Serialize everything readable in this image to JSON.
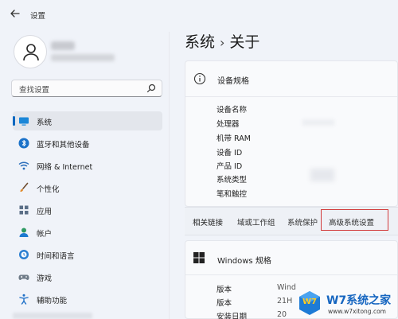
{
  "window": {
    "title": "设置"
  },
  "search": {
    "placeholder": "查找设置"
  },
  "sidebar": {
    "items": [
      {
        "label": "系统",
        "icon": "monitor-icon",
        "active": true
      },
      {
        "label": "蓝牙和其他设备",
        "icon": "bluetooth-icon"
      },
      {
        "label": "网络 & Internet",
        "icon": "wifi-icon"
      },
      {
        "label": "个性化",
        "icon": "brush-icon"
      },
      {
        "label": "应用",
        "icon": "apps-icon"
      },
      {
        "label": "帐户",
        "icon": "account-icon"
      },
      {
        "label": "时间和语言",
        "icon": "globe-clock-icon"
      },
      {
        "label": "游戏",
        "icon": "gamepad-icon"
      },
      {
        "label": "辅助功能",
        "icon": "accessibility-icon"
      }
    ]
  },
  "breadcrumb": {
    "parent": "系统",
    "separator": "›",
    "current": "关于"
  },
  "device_specs": {
    "title": "设备规格",
    "rows": [
      {
        "label": "设备名称"
      },
      {
        "label": "处理器"
      },
      {
        "label": "机带 RAM"
      },
      {
        "label": "设备 ID"
      },
      {
        "label": "产品 ID"
      },
      {
        "label": "系统类型"
      },
      {
        "label": "笔和触控"
      }
    ]
  },
  "related_links": {
    "label": "相关链接",
    "links": [
      "域或工作组",
      "系统保护",
      "高级系统设置"
    ]
  },
  "windows_specs": {
    "title": "Windows 规格",
    "rows": [
      {
        "label": "版本",
        "value": "Wind"
      },
      {
        "label": "版本",
        "value": "21H"
      },
      {
        "label": "安装日期",
        "value": "20"
      }
    ]
  },
  "watermark": {
    "badge": "W7",
    "text": "W7系统之家",
    "url": "www.w7xitong.com"
  },
  "colors": {
    "accent": "#0067c0",
    "highlight_box": "#d23b3b",
    "background": "#f0f3f9"
  }
}
